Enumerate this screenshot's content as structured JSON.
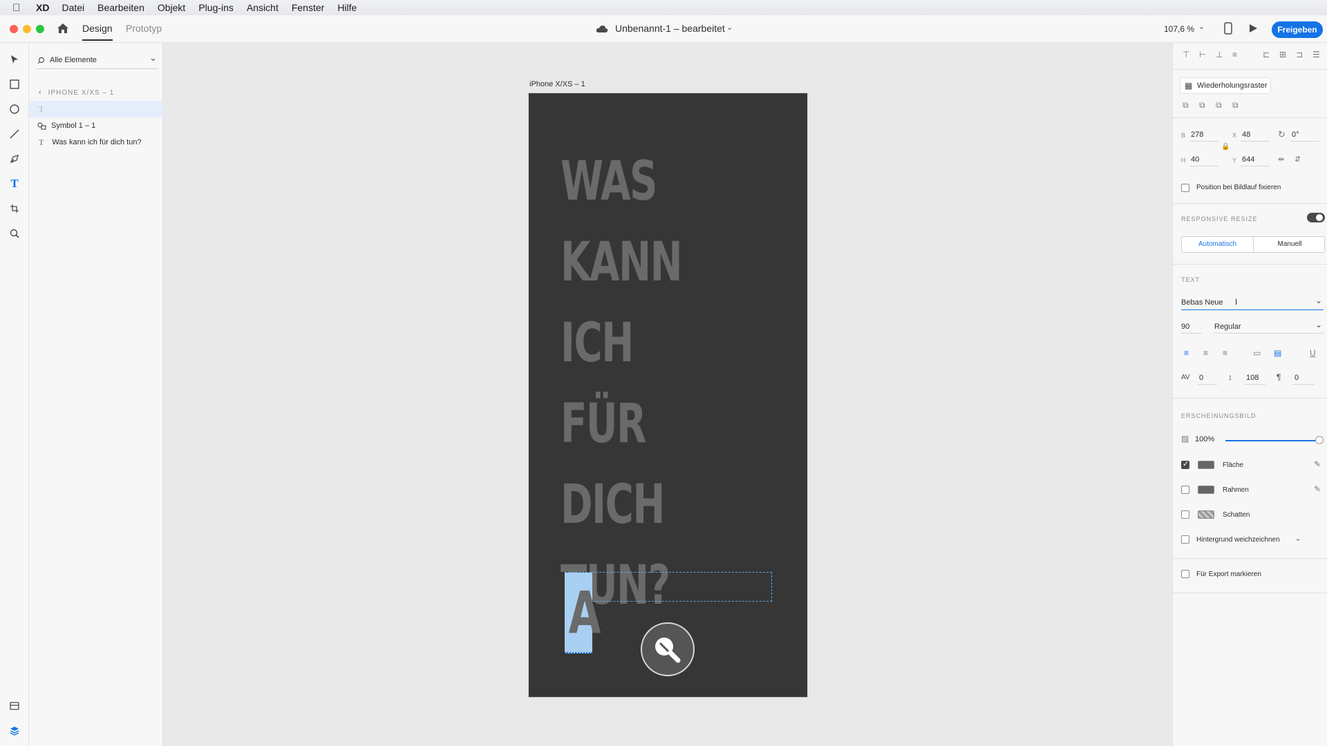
{
  "menubar": {
    "app": "XD",
    "items": [
      "Datei",
      "Bearbeiten",
      "Objekt",
      "Plug-ins",
      "Ansicht",
      "Fenster",
      "Hilfe"
    ]
  },
  "titlebar": {
    "tabs": [
      "Design",
      "Prototyp"
    ],
    "doc_title": "Unbenannt-1 – bearbeitet",
    "zoom": "107,6 %",
    "share_label": "Freigeben"
  },
  "layers": {
    "search_placeholder": "Alle Elemente",
    "breadcrumb": "IPHONE X/XS – 1",
    "items": [
      {
        "label": "",
        "icon": "text-icon"
      },
      {
        "label": "Symbol 1 – 1",
        "icon": "symbol-icon"
      },
      {
        "label": "Was kann ich für dich tun?",
        "icon": "text-icon"
      }
    ]
  },
  "canvas": {
    "artboard_label": "iPhone X/XS – 1",
    "headline": "WAS\nKANN ICH\nFÜR DICH\nTUN?",
    "cursor_text": "A"
  },
  "props": {
    "repeat_grid": "Wiederholungsraster",
    "w_label": "B",
    "w": "278",
    "h_label": "H",
    "h": "40",
    "x_label": "X",
    "x": "48",
    "y_label": "Y",
    "y": "644",
    "rotation": "0°",
    "fix_position": "Position bei Bildlauf fixieren",
    "responsive_title": "RESPONSIVE RESIZE",
    "responsive_auto": "Automatisch",
    "responsive_manual": "Manuell",
    "text_title": "TEXT",
    "font": "Bebas Neue",
    "font_size": "90",
    "font_weight": "Regular",
    "char_spacing": "0",
    "line_spacing": "108",
    "para_spacing": "0",
    "appearance_title": "ERSCHEINUNGSBILD",
    "opacity": "100%",
    "opacity_value": 1.0,
    "fill": "Fläche",
    "fill_checked": true,
    "border": "Rahmen",
    "border_checked": false,
    "shadow": "Schatten",
    "shadow_checked": false,
    "bg_blur": "Hintergrund weichzeichnen",
    "bg_blur_checked": false,
    "export": "Für Export markieren",
    "export_checked": false
  },
  "colors": {
    "accent": "#1473e6",
    "artboard": "#363636",
    "headline": "#6a6a6a"
  }
}
